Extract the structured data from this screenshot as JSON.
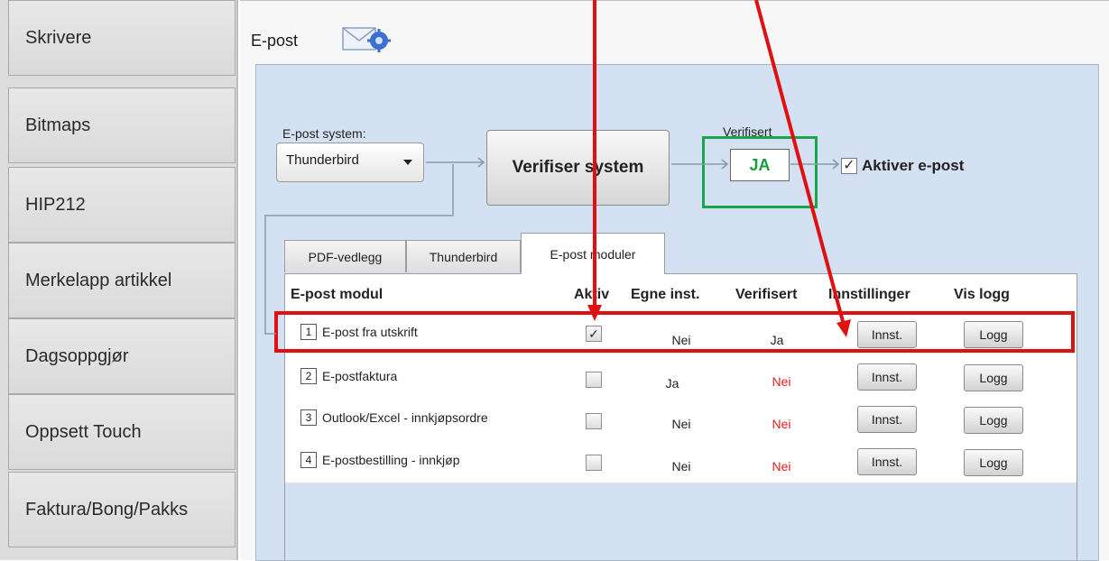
{
  "sidebar": {
    "items": [
      {
        "label": "Skrivere"
      },
      {
        "label": "Bitmaps"
      },
      {
        "label": "HIP212"
      },
      {
        "label": "Merkelapp artikkel"
      },
      {
        "label": "Dagsoppgjør"
      },
      {
        "label": "Oppsett Touch"
      },
      {
        "label": "Faktura/Bong/Pakks"
      }
    ]
  },
  "main": {
    "title": "E-post",
    "title_icon": "mail-gear-icon"
  },
  "flow": {
    "system_label": "E-post system:",
    "system_value": "Thunderbird",
    "verify_button": "Verifiser system",
    "verified_caption": "Verifisert",
    "verified_value": "JA",
    "activate_checked": true,
    "activate_mark": "✓",
    "activate_label": "Aktiver e-post"
  },
  "tabs": [
    {
      "label": "PDF-vedlegg",
      "active": false
    },
    {
      "label": "Thunderbird",
      "active": false
    },
    {
      "label": "E-post moduler",
      "active": true
    }
  ],
  "table": {
    "headers": {
      "module": "E-post modul",
      "active": "Aktiv",
      "own": "Egne inst.",
      "verified": "Verifisert",
      "settings": "Innstillinger",
      "log": "Vis logg"
    },
    "rows": [
      {
        "num": "1",
        "name": "E-post fra utskrift",
        "active": true,
        "active_mark": "✓",
        "own": "Nei",
        "verified": "Ja",
        "settings_btn": "Innst.",
        "log_btn": "Logg"
      },
      {
        "num": "2",
        "name": "E-postfaktura",
        "active": false,
        "active_mark": "",
        "own": "Ja",
        "verified": "Nei",
        "settings_btn": "Innst.",
        "log_btn": "Logg"
      },
      {
        "num": "3",
        "name": "Outlook/Excel - innkjøpsordre",
        "active": false,
        "active_mark": "",
        "own": "Nei",
        "verified": "Nei",
        "settings_btn": "Innst.",
        "log_btn": "Logg"
      },
      {
        "num": "4",
        "name": "E-postbestilling - innkjøp",
        "active": false,
        "active_mark": "",
        "own": "Nei",
        "verified": "Nei",
        "settings_btn": "Innst.",
        "log_btn": "Logg"
      }
    ]
  },
  "colors": {
    "panel_bg": "#d4e1f2",
    "verified_green": "#1aa64a",
    "negative_red": "#e02020",
    "annotation_red": "#e01010"
  }
}
